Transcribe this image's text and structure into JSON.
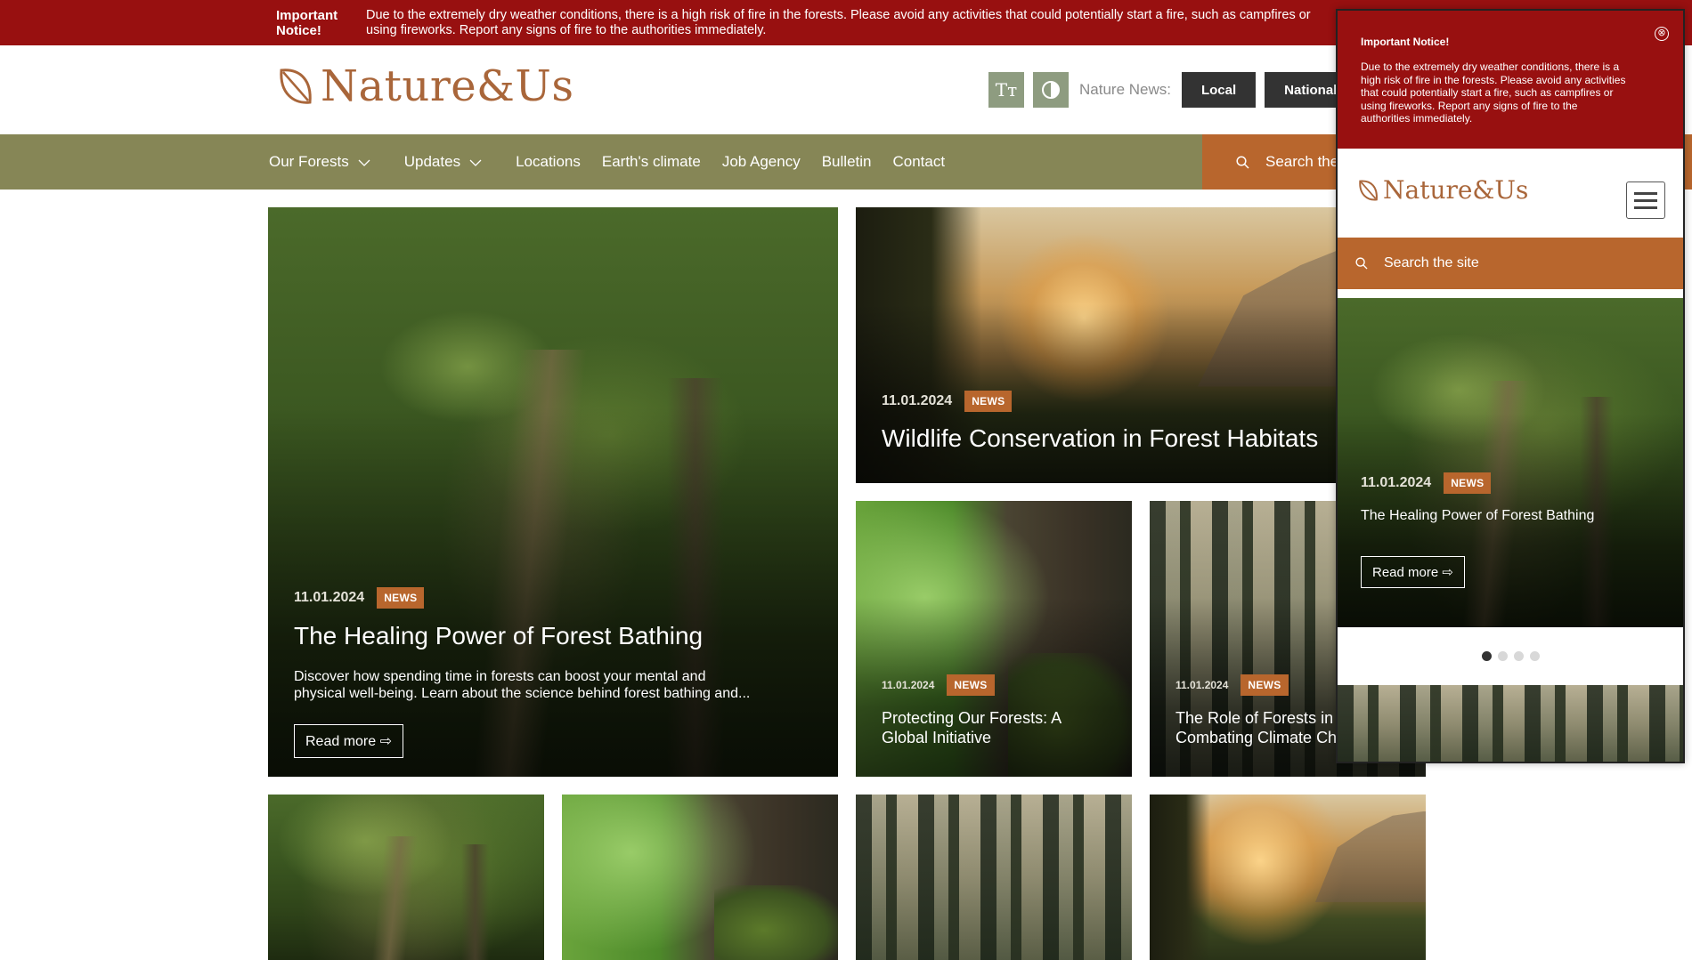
{
  "alert": {
    "title": "Important Notice!",
    "message_line1": "Due to the extremely dry weather conditions, there is a high risk of fire in the forests. Please avoid any activities that could potentially start a fire, such as campfires or",
    "message_line2": "using fireworks. Report any signs of fire to the authorities immediately."
  },
  "header": {
    "logo_text": "Nature&Us",
    "text_size_icon": "Tт",
    "nature_news_label": "Nature News:",
    "local_label": "Local",
    "national_label": "National"
  },
  "nav": {
    "items": [
      {
        "label": "Our Forests",
        "has_dropdown": true
      },
      {
        "label": "Updates",
        "has_dropdown": true
      },
      {
        "label": "Locations",
        "has_dropdown": false
      },
      {
        "label": "Earth's climate",
        "has_dropdown": false
      },
      {
        "label": "Job Agency",
        "has_dropdown": false
      },
      {
        "label": "Bulletin",
        "has_dropdown": false
      },
      {
        "label": "Contact",
        "has_dropdown": false
      }
    ],
    "search_placeholder": "Search the site"
  },
  "cards": {
    "featured": {
      "date": "11.01.2024",
      "badge": "NEWS",
      "title": "The Healing Power of Forest Bathing",
      "excerpt_line1": "Discover how spending time in forests can boost your mental and",
      "excerpt_line2": "physical well-being. Learn about the science behind forest bathing and...",
      "read_more": "Read more ⇨"
    },
    "wildlife": {
      "date": "11.01.2024",
      "badge": "NEWS",
      "title": "Wildlife Conservation in Forest Habitats"
    },
    "protecting": {
      "date": "11.01.2024",
      "badge": "NEWS",
      "title_line1": "Protecting Our Forests: A",
      "title_line2": "Global Initiative"
    },
    "role": {
      "date": "11.01.2024",
      "badge": "NEWS",
      "title_line1": "The Role of Forests in",
      "title_line2": "Combating Climate Change"
    }
  },
  "popup": {
    "alert_title": "Important Notice!",
    "alert_message": "Due to the extremely dry weather conditions, there is a high risk of fire in the forests. Please avoid any activities that could potentially start a fire, such as campfires or using fireworks. Report any signs of fire to the authorities immediately.",
    "close_icon": "⊗",
    "logo_text": "Nature&Us",
    "search_placeholder": "Search the site",
    "slide": {
      "date": "11.01.2024",
      "badge": "NEWS",
      "title": "The Healing Power of Forest Bathing",
      "read_more": "Read more ⇨"
    },
    "slider_dots": 4,
    "active_dot": 1
  },
  "colors": {
    "alert_red": "#981010",
    "nav_olive": "#868656",
    "accent_orange": "#b8662d",
    "logo_brown": "#a9663a"
  }
}
